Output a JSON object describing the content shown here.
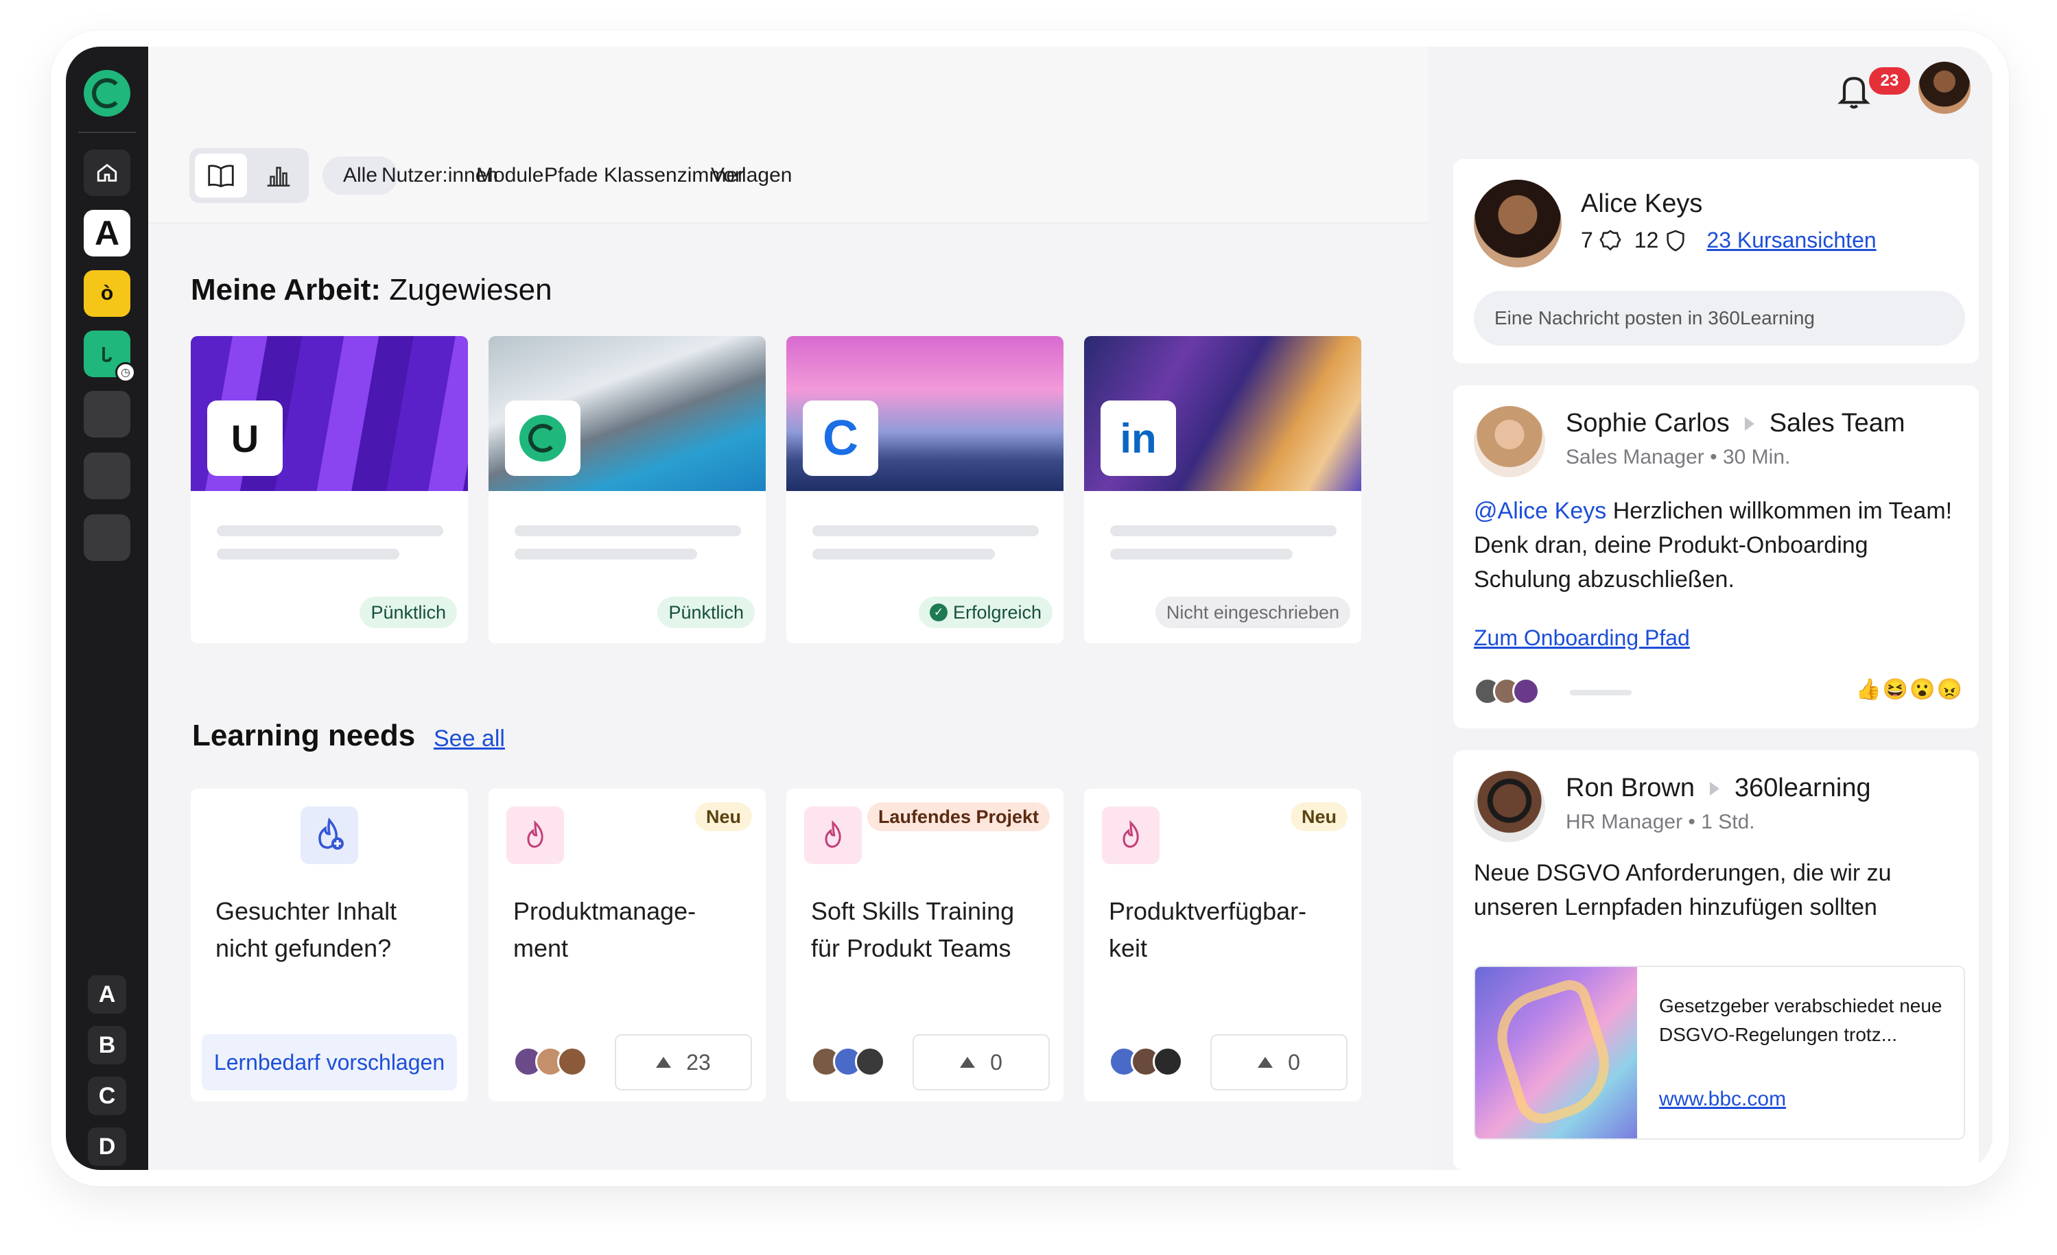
{
  "header": {
    "notification_count": "23"
  },
  "sidebar": {
    "home_icon": "home-icon",
    "apps": [
      {
        "label": "A"
      },
      {
        "label": "ò"
      }
    ],
    "letters": [
      "A",
      "B",
      "C",
      "D"
    ]
  },
  "filters": {
    "tabs": [
      {
        "label": "Alle",
        "active": true
      },
      {
        "label": "Nutzer:innen"
      },
      {
        "label": "Module"
      },
      {
        "label": "Pfade"
      },
      {
        "label": "Klassenzimmer"
      },
      {
        "label": "Vorlagen"
      }
    ]
  },
  "my_work": {
    "title_bold": "Meine Arbeit:",
    "title_rest": " Zugewiesen",
    "courses": [
      {
        "logo": "U",
        "status": "Pünktlich",
        "status_type": "green"
      },
      {
        "logo": "",
        "status": "Pünktlich",
        "status_type": "green"
      },
      {
        "logo": "C",
        "status": "Erfolgreich",
        "status_type": "success"
      },
      {
        "logo": "in",
        "status": "Nicht eingeschrieben",
        "status_type": "gray"
      }
    ]
  },
  "learning_needs": {
    "title": "Learning needs",
    "see_all": "See all",
    "cards": [
      {
        "title": "Gesuchter Inhalt nicht gefunden?",
        "cta": "Lernbedarf vorschlagen"
      },
      {
        "title": "Produktmanage-ment",
        "badge": "Neu",
        "votes": "23"
      },
      {
        "title": "Soft Skills Training für Produkt Teams",
        "badge": "Laufendes Projekt",
        "votes": "0"
      },
      {
        "title": "Produktverfügbar-keit",
        "badge": "Neu",
        "votes": "0"
      }
    ]
  },
  "profile": {
    "name": "Alice Keys",
    "stat1": "7",
    "stat2": "12",
    "course_views": "23 Kursansichten",
    "post_placeholder": "Eine Nachricht posten in 360Learning"
  },
  "posts": [
    {
      "author": "Sophie Carlos",
      "group": "Sales Team",
      "role": "Sales Manager • 30 Min.",
      "mention": "@Alice Keys",
      "text": " Herzlichen willkommen im Team! Denk dran, deine Produkt-Onboarding Schulung abzuschließen.",
      "link": "Zum Onboarding Pfad"
    },
    {
      "author": "Ron Brown",
      "group": "360learning",
      "role": "HR Manager • 1 Std.",
      "text": "Neue DSGVO Anforderungen, die wir zu unseren Lernpfaden hinzufügen sollten",
      "preview_title": "Gesetzgeber verabschiedet neue DSGVO-Regelungen trotz...",
      "preview_link": "www.bbc.com"
    }
  ],
  "colors": {
    "accent": "#1c4ed8",
    "brand_green": "#1fb77c",
    "badge_red": "#e5303a"
  }
}
